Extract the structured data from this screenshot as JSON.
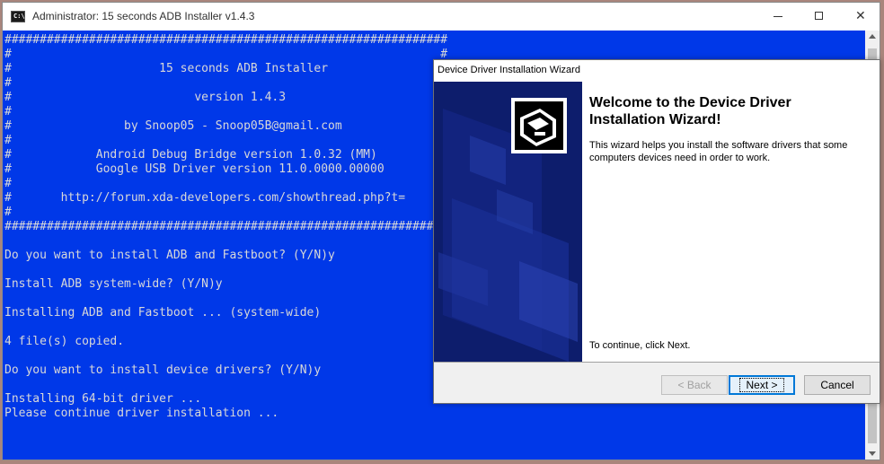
{
  "window": {
    "title": "Administrator:  15 seconds ADB Installer v1.4.3",
    "icon": "console-icon",
    "icon_text": "C:\\",
    "close_glyph": "✕"
  },
  "console": {
    "lines": [
      "###############################################################",
      "#                                                             #",
      "#                     15 seconds ADB Installer                #",
      "#                                                             #",
      "#                          version 1.4.3                      #",
      "#                                                             #",
      "#                by Snoop05 - Snoop05B@gmail.com              #",
      "#                                                             #",
      "#            Android Debug Bridge version 1.0.32 (MM)         #",
      "#            Google USB Driver version 11.0.0000.00000        #",
      "#                                                             #",
      "#       http://forum.xda-developers.com/showthread.php?t=     #",
      "#                                                             #",
      "###############################################################",
      "",
      "Do you want to install ADB and Fastboot? (Y/N)y",
      "",
      "Install ADB system-wide? (Y/N)y",
      "",
      "Installing ADB and Fastboot ... (system-wide)",
      "",
      "4 file(s) copied.",
      "",
      "Do you want to install device drivers? (Y/N)y",
      "",
      "Installing 64-bit driver ...",
      "Please continue driver installation ..."
    ],
    "background": "#0038e8",
    "foreground": "#d8d8d8"
  },
  "wizard": {
    "title": "Device Driver Installation Wizard",
    "heading": "Welcome to the Device Driver Installation Wizard!",
    "description": "This wizard helps you install the software drivers that some computers devices need in order to work.",
    "continue_text": "To continue, click Next.",
    "side_icon": "hardware-device-icon",
    "buttons": {
      "back": "< Back",
      "next": "Next >",
      "cancel": "Cancel"
    }
  }
}
